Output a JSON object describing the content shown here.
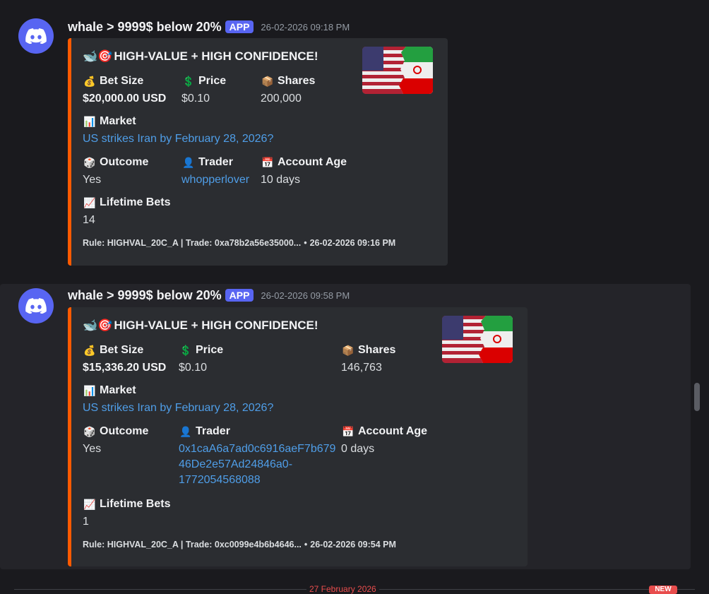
{
  "messages": [
    {
      "username": "whale > 9999$ below 20%",
      "app_badge": "APP",
      "timestamp": "26-02-2026 09:18 PM",
      "embed": {
        "title_emojis": "🐋🎯",
        "title": "HIGH-VALUE + HIGH CONFIDENCE!",
        "bet_size_label": "Bet Size",
        "bet_size_icon": "💰",
        "bet_size": "$20,000.00 USD",
        "price_label": "Price",
        "price_icon": "💲",
        "price": "$0.10",
        "shares_label": "Shares",
        "shares_icon": "📦",
        "shares": "200,000",
        "market_label": "Market",
        "market_icon": "📊",
        "market": "US strikes Iran by February 28, 2026?",
        "outcome_label": "Outcome",
        "outcome_icon": "🎲",
        "outcome": "Yes",
        "trader_label": "Trader",
        "trader_icon": "👤",
        "trader": "whopperlover",
        "account_age_label": "Account Age",
        "account_age_icon": "📅",
        "account_age": "10 days",
        "lifetime_bets_label": "Lifetime Bets",
        "lifetime_bets_icon": "📈",
        "lifetime_bets": "14",
        "footer": "Rule: HIGHVAL_20C_A | Trade: 0xa78b2a56e35000...",
        "footer_dot": "•",
        "footer_time": "26-02-2026 09:16 PM"
      }
    },
    {
      "username": "whale > 9999$ below 20%",
      "app_badge": "APP",
      "timestamp": "26-02-2026 09:58 PM",
      "embed": {
        "title_emojis": "🐋🎯",
        "title": "HIGH-VALUE + HIGH CONFIDENCE!",
        "bet_size_label": "Bet Size",
        "bet_size_icon": "💰",
        "bet_size": "$15,336.20 USD",
        "price_label": "Price",
        "price_icon": "💲",
        "price": "$0.10",
        "shares_label": "Shares",
        "shares_icon": "📦",
        "shares": "146,763",
        "market_label": "Market",
        "market_icon": "📊",
        "market": "US strikes Iran by February 28, 2026?",
        "outcome_label": "Outcome",
        "outcome_icon": "🎲",
        "outcome": "Yes",
        "trader_label": "Trader",
        "trader_icon": "👤",
        "trader_line1": "0x1caA6a7ad0c6916aeF7b679",
        "trader_line2": "46De2e57Ad24846a0-",
        "trader_line3": "1772054568088",
        "account_age_label": "Account Age",
        "account_age_icon": "📅",
        "account_age": "0 days",
        "lifetime_bets_label": "Lifetime Bets",
        "lifetime_bets_icon": "📈",
        "lifetime_bets": "1",
        "footer": "Rule: HIGHVAL_20C_A | Trade: 0xc0099e4b6b4646...",
        "footer_dot": "•",
        "footer_time": "26-02-2026 09:54 PM"
      }
    }
  ],
  "divider": {
    "date": "27 February 2026",
    "new_label": "NEW"
  },
  "colors": {
    "accent": "#5865f2",
    "embed_bar": "#ff5a00",
    "link": "#4f9ee8"
  }
}
